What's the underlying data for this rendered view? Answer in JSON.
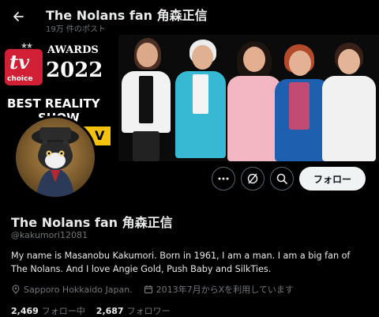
{
  "header": {
    "title": "The Nolans fan 角森正信",
    "post_count": "19万 件のポスト"
  },
  "banner": {
    "logo_top": "tv",
    "logo_bottom": "choice",
    "awards_label": "AWARDS",
    "awards_year": "2022",
    "headline_1": "BEST REALITY",
    "headline_2": "SHOW",
    "strip_text": "V"
  },
  "profile": {
    "display_name": "The Nolans fan 角森正信",
    "handle": "@kakumori12081",
    "bio": "My name is Masanobu Kakumori. Born in 1961, I am a man. I am a big fan of The Nolans. And I love Angie Gold, Push Baby and SilkTies.",
    "location": "Sapporo Hokkaido Japan.",
    "joined": "2013年7月からXを利用しています"
  },
  "actions": {
    "follow_label": "フォロー"
  },
  "stats": {
    "following_count": "2,469",
    "following_label": "フォロー中",
    "followers_count": "2,687",
    "followers_label": "フォロワー"
  },
  "icons": [
    "back-arrow-icon",
    "more-icon",
    "grok-icon",
    "search-icon",
    "location-icon",
    "calendar-icon"
  ],
  "colors": {
    "background": "#000000",
    "text_primary": "#e7e9ea",
    "text_secondary": "#71767b",
    "follow_button_bg": "#eff3f4",
    "banner_red": "#d11f35",
    "banner_yellow": "#f4c20d"
  }
}
